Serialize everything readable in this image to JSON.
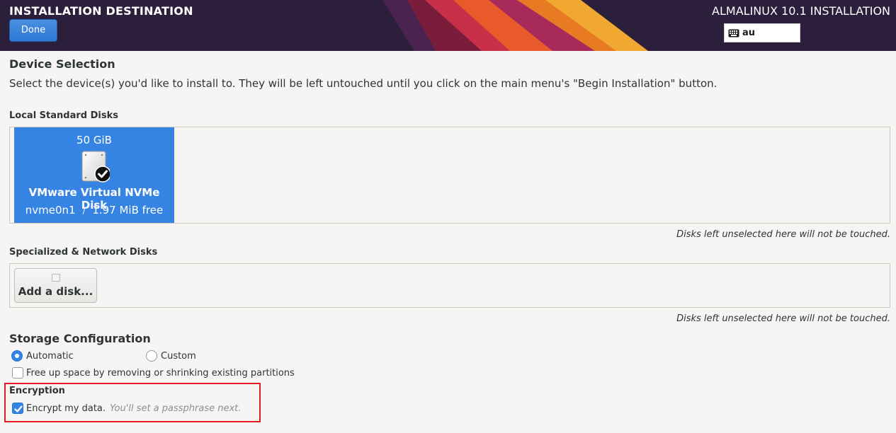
{
  "header": {
    "spoke_title": "INSTALLATION DESTINATION",
    "done_label": "Done",
    "product_title": "ALMALINUX 10.1 INSTALLATION",
    "keyboard_layout": "au",
    "keyboard_icon": "keyboard-icon"
  },
  "device_selection": {
    "title": "Device Selection",
    "description": "Select the device(s) you'd like to install to.  They will be left untouched until you click on the main menu's \"Begin Installation\" button."
  },
  "local_disks": {
    "title": "Local Standard Disks",
    "disks": [
      {
        "size": "50 GiB",
        "name": "VMware Virtual NVMe Disk",
        "device": "nvme0n1",
        "separator": "/",
        "free": "1.97 MiB free",
        "selected": true,
        "icon": "harddisk-checked-icon"
      }
    ],
    "note": "Disks left unselected here will not be touched."
  },
  "specialized_disks": {
    "title": "Specialized & Network Disks",
    "add_disk_label": "Add a disk...",
    "note": "Disks left unselected here will not be touched."
  },
  "storage_config": {
    "title": "Storage Configuration",
    "automatic_label": "Automatic",
    "custom_label": "Custom",
    "selected": "Automatic",
    "free_space_label": "Free up space by removing or shrinking existing partitions",
    "free_space_checked": false
  },
  "encryption": {
    "title": "Encryption",
    "encrypt_label": "Encrypt my data.",
    "encrypt_hint": "You'll set a passphrase next.",
    "encrypt_checked": true
  },
  "colors": {
    "accent": "#3584e4",
    "highlight": "#e01b24",
    "header_bg": "#2b1f3c"
  }
}
